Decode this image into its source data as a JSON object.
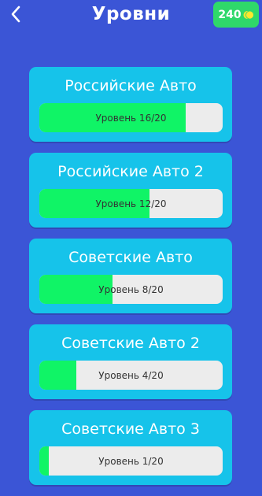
{
  "header": {
    "title": "Уровни",
    "coins": "240"
  },
  "levels": [
    {
      "title": "Российские Авто",
      "progress_label": "Уровень 16/20",
      "done": 16,
      "total": 20
    },
    {
      "title": "Российские Авто 2",
      "progress_label": "Уровень 12/20",
      "done": 12,
      "total": 20
    },
    {
      "title": "Советские Авто",
      "progress_label": "Уровень 8/20",
      "done": 8,
      "total": 20
    },
    {
      "title": "Советские Авто 2",
      "progress_label": "Уровень 4/20",
      "done": 4,
      "total": 20
    },
    {
      "title": "Советские Авто 3",
      "progress_label": "Уровень 1/20",
      "done": 1,
      "total": 20
    }
  ],
  "colors": {
    "background": "#3b55d6",
    "card": "#16c3ea",
    "progress_fill": "#10f466",
    "progress_track": "#ececec",
    "coins_badge": "#2fd86a",
    "coin": "#ffe62e"
  },
  "icons": {
    "back": "chevron-left-icon",
    "coin": "coin-icon"
  }
}
